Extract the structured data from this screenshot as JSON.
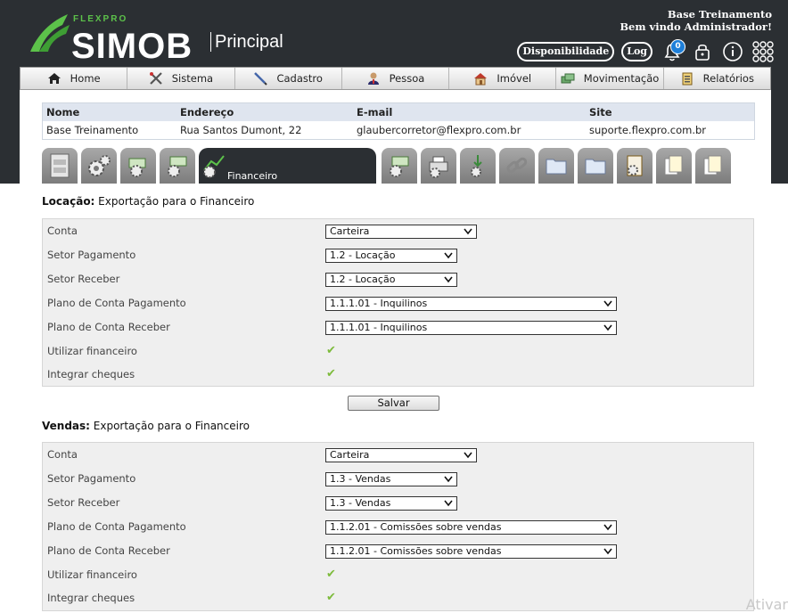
{
  "header": {
    "brand_small": "FLEXPRO",
    "brand": "SIMOB",
    "module": "Principal",
    "user_line1": "Base Treinamento",
    "user_line2": "Bem vindo Administrador!",
    "btn_disponibilidade": "Disponibilidade",
    "btn_log": "Log",
    "notifications_count": "0"
  },
  "nav": [
    {
      "label": "Home",
      "icon": "home-icon"
    },
    {
      "label": "Sistema",
      "icon": "tools-icon"
    },
    {
      "label": "Cadastro",
      "icon": "pencil-icon"
    },
    {
      "label": "Pessoa",
      "icon": "person-icon"
    },
    {
      "label": "Imóvel",
      "icon": "house-icon"
    },
    {
      "label": "Movimentação",
      "icon": "money-icon"
    },
    {
      "label": "Relatórios",
      "icon": "clipboard-icon"
    }
  ],
  "info": {
    "headers": [
      "Nome",
      "Endereço",
      "E-mail",
      "Site"
    ],
    "values": [
      "Base Treinamento",
      "Rua Santos Dumont, 22",
      "glaubercorretor@flexpro.com.br",
      "suporte.flexpro.com.br"
    ]
  },
  "tabs": {
    "active_label": "Financeiro"
  },
  "locacao": {
    "title_bold": "Locação:",
    "title_rest": " Exportação para o Financeiro",
    "labels": [
      "Conta",
      "Setor Pagamento",
      "Setor Receber",
      "Plano de Conta Pagamento",
      "Plano de Conta Receber",
      "Utilizar financeiro",
      "Integrar cheques"
    ],
    "values": [
      "Carteira",
      "1.2 - Locação",
      "1.2 - Locação",
      "1.1.1.01 - Inquilinos",
      "1.1.1.01 - Inquilinos"
    ]
  },
  "save_label": "Salvar",
  "vendas": {
    "title_bold": "Vendas:",
    "title_rest": " Exportação para o Financeiro",
    "labels": [
      "Conta",
      "Setor Pagamento",
      "Setor Receber",
      "Plano de Conta Pagamento",
      "Plano de Conta Receber",
      "Utilizar financeiro",
      "Integrar cheques"
    ],
    "values": [
      "Carteira",
      "1.3 - Vendas",
      "1.3 - Vendas",
      "1.1.2.01 - Comissões sobre vendas",
      "1.1.2.01 - Comissões sobre vendas"
    ]
  },
  "watermark": "Ativar",
  "check_glyph": "✔",
  "colors": {
    "header_bg": "#2b2f33",
    "accent_green": "#5cc24a",
    "badge_blue": "#1e7fd9",
    "check_green": "#7dbb3c"
  }
}
